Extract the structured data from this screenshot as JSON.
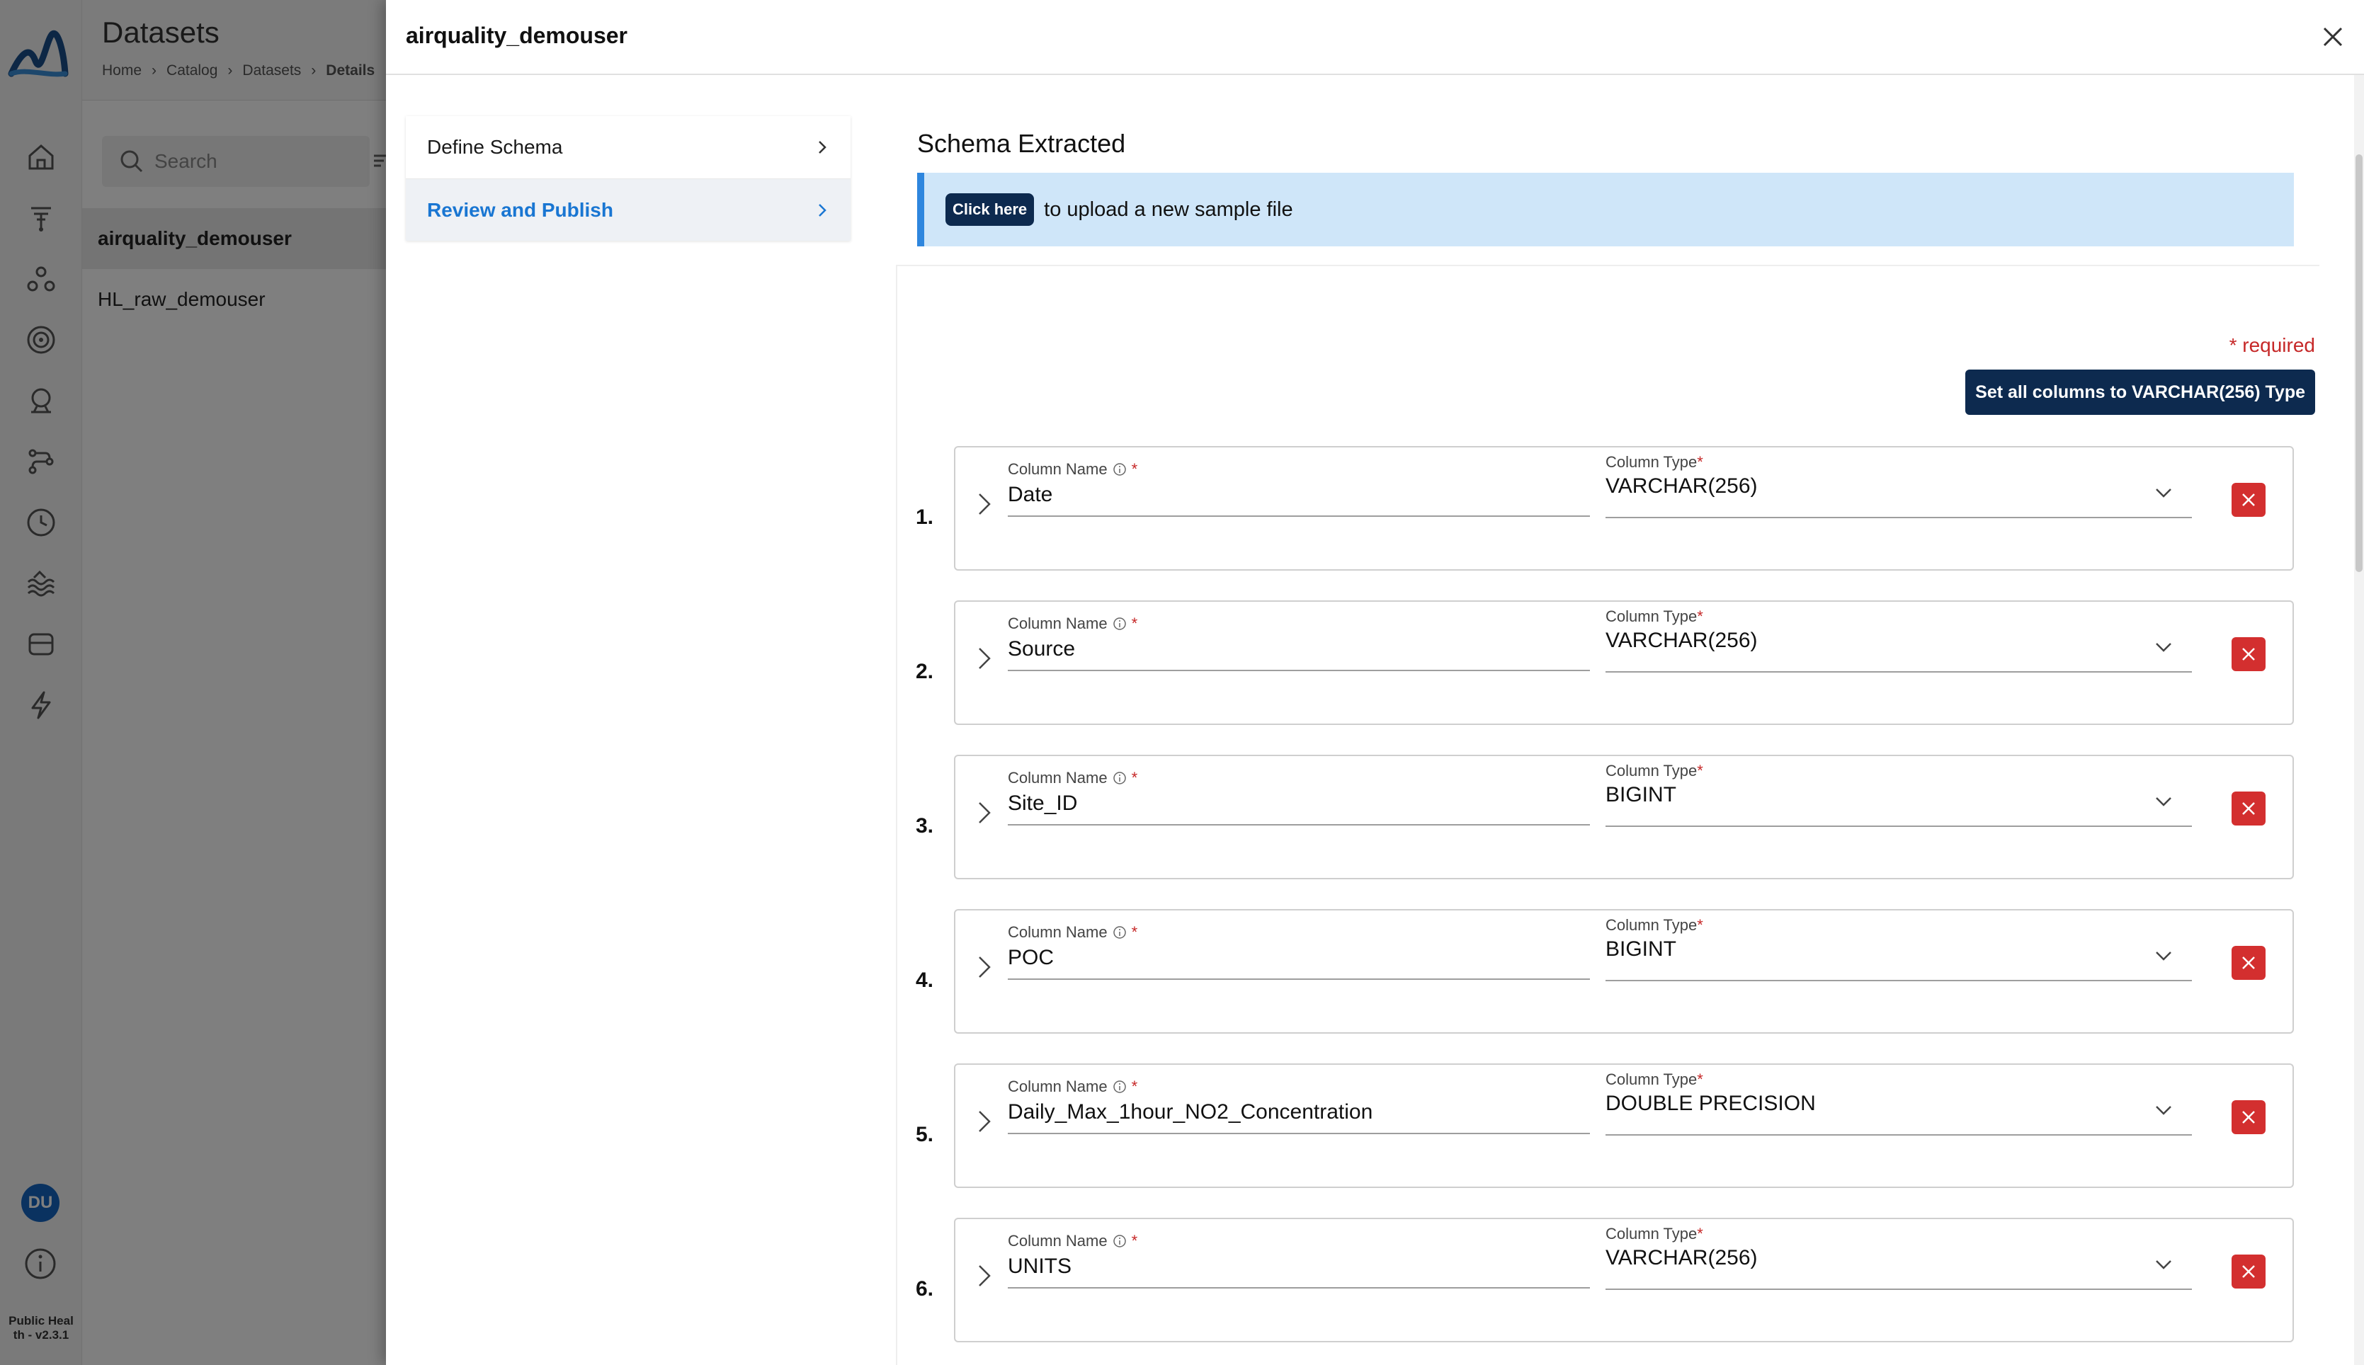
{
  "background": {
    "page_title": "Datasets",
    "breadcrumb": [
      "Home",
      "Catalog",
      "Datasets",
      "Details"
    ],
    "search_placeholder": "Search",
    "datasets": [
      "airquality_demouser",
      "HL_raw_demouser"
    ],
    "user_initials": "DU",
    "version_line1": "Public Heal",
    "version_line2": "th - v2.3.1"
  },
  "drawer": {
    "title": "airquality_demouser",
    "steps": [
      {
        "label": "Define Schema",
        "active": false
      },
      {
        "label": "Review and Publish",
        "active": true
      }
    ],
    "schema_heading": "Schema Extracted",
    "upload_banner": {
      "link_label": "Click here",
      "text": "to upload a new sample file"
    },
    "required_note": "* required",
    "set_all_button": "Set all columns to VARCHAR(256) Type",
    "column_name_label": "Column Name",
    "column_type_label": "Column Type",
    "required_mark": "*",
    "columns": [
      {
        "index": "1.",
        "name": "Date",
        "type": "VARCHAR(256)"
      },
      {
        "index": "2.",
        "name": "Source",
        "type": "VARCHAR(256)"
      },
      {
        "index": "3.",
        "name": "Site_ID",
        "type": "BIGINT"
      },
      {
        "index": "4.",
        "name": "POC",
        "type": "BIGINT"
      },
      {
        "index": "5.",
        "name": "Daily_Max_1hour_NO2_Concentration",
        "type": "DOUBLE PRECISION"
      },
      {
        "index": "6.",
        "name": "UNITS",
        "type": "VARCHAR(256)"
      }
    ]
  },
  "colors": {
    "primary_dark": "#0d2a4f",
    "accent_blue": "#1976d2",
    "banner_bg": "#cfe6f9",
    "danger": "#d32f2f"
  },
  "icons": [
    "logo-icon",
    "home-icon",
    "pipeline-icon",
    "share-icon",
    "target-icon",
    "explorer-icon",
    "flow-icon",
    "clock-icon",
    "lake-icon",
    "database-icon",
    "bolt-icon",
    "info-icon",
    "search-icon",
    "filter-icon",
    "close-icon",
    "chevron-right-icon",
    "chevron-down-icon",
    "delete-icon"
  ]
}
